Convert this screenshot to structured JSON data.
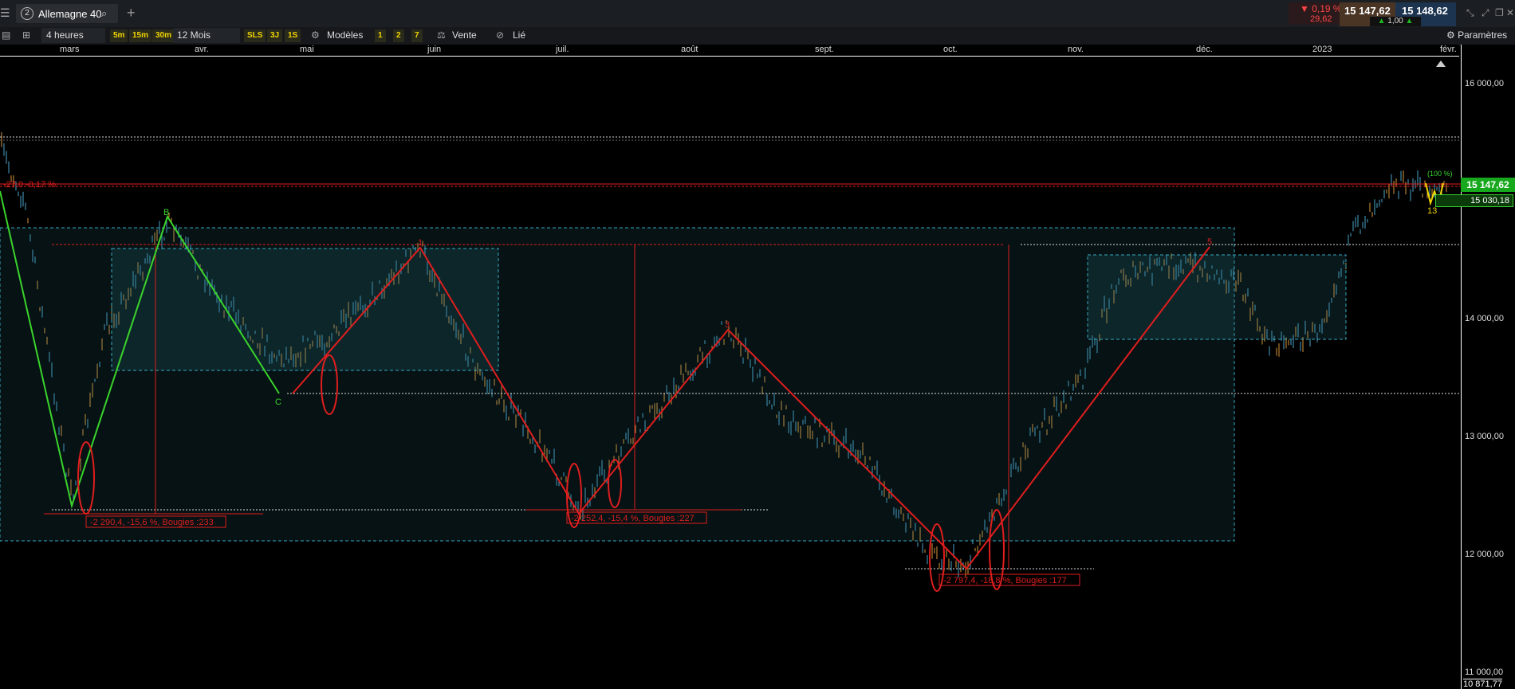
{
  "topbar": {
    "tab_number": "2",
    "instrument": "Allemagne 40",
    "change_pct": "▼ 0,19 %",
    "change_abs": "29,62",
    "bid": "15 147,62",
    "ask": "15 148,62",
    "spread": "1,00"
  },
  "toolbar": {
    "interval": "4 heures",
    "presets": [
      "5m",
      "15m",
      "30m"
    ],
    "range": "12 Mois",
    "extra": [
      "SLS",
      "3J",
      "1S"
    ],
    "models_label": "Modèles",
    "quick": [
      "1",
      "2",
      "7"
    ],
    "sell_label": "Vente",
    "linked_label": "Lié",
    "settings_label": "Paramètres"
  },
  "xaxis_labels": [
    "mars",
    "avr.",
    "mai",
    "juin",
    "juil.",
    "août",
    "sept.",
    "oct.",
    "nov.",
    "déc.",
    "2023",
    "févr."
  ],
  "yaxis_labels": [
    "16 000,00",
    "14 000,00",
    "13 000,00",
    "12 000,00",
    "11 000,00"
  ],
  "price_tags": {
    "last": "15 147,62",
    "secondary": "15 030,18",
    "bottom": "10 871,77"
  },
  "annotations": {
    "m1": "-2 290,4, -15,6 %, Bougies :233",
    "m2": "-2 252,4, -15,4 %, Bougies :227",
    "m3": "-2 797,4, -18,8 %, Bougies :177",
    "top_left": "-27.0 -0,17 %",
    "wave_b": "B",
    "wave_c": "C",
    "wave_1": "1",
    "wave_3": "3",
    "wave_5": "5",
    "small_13": "13",
    "small_pct": "(100 %)"
  },
  "colors": {
    "red": "#e01e1e",
    "green": "#3ad42c",
    "cyan": "#35a9c0",
    "up": "#4aa3c8",
    "down": "#d8963a"
  }
}
